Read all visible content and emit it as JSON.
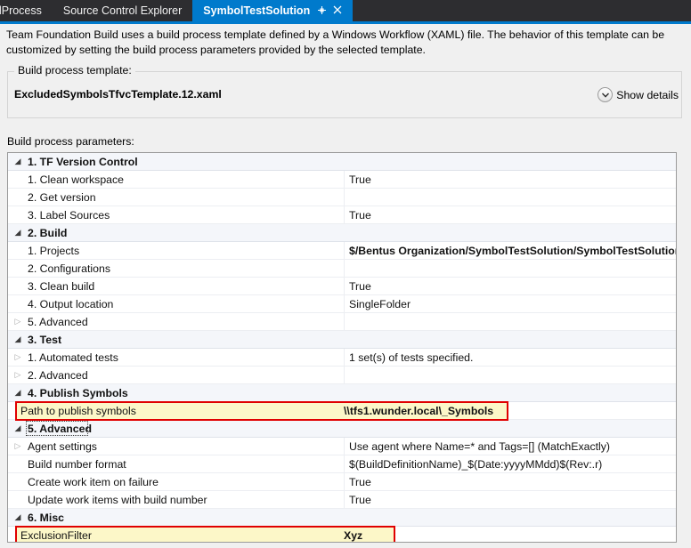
{
  "tabs": [
    {
      "label": "ldProcess",
      "active": false,
      "truncated": true
    },
    {
      "label": "Source Control Explorer",
      "active": false
    },
    {
      "label": "SymbolTestSolution",
      "active": true,
      "pin_icon": "pin-icon",
      "close_icon": "close-icon"
    }
  ],
  "intro": {
    "text": "Team Foundation Build uses a build process template defined by a Windows Workflow (XAML) file. The behavior of this template can be customized by setting the build process parameters provided by the selected template."
  },
  "template_group": {
    "legend": "Build process template:",
    "template_name": "ExcludedSymbolsTfvcTemplate.12.xaml",
    "show_details_label": "Show details",
    "show_details_icon": "chevron-down-circle-icon"
  },
  "params": {
    "label": "Build process parameters:",
    "rows": [
      {
        "type": "group",
        "expander": "open",
        "name": "1. TF Version Control",
        "value": ""
      },
      {
        "type": "item",
        "expander": "none",
        "name": "1. Clean workspace",
        "value": "True"
      },
      {
        "type": "item",
        "expander": "none",
        "name": "2. Get version",
        "value": ""
      },
      {
        "type": "item",
        "expander": "none",
        "name": "3. Label Sources",
        "value": "True"
      },
      {
        "type": "group",
        "expander": "open",
        "name": "2. Build",
        "value": ""
      },
      {
        "type": "item",
        "expander": "none",
        "name": "1. Projects",
        "value": "$/Bentus Organization/SymbolTestSolution/SymbolTestSolution.sln",
        "bold": true
      },
      {
        "type": "item",
        "expander": "none",
        "name": "2. Configurations",
        "value": ""
      },
      {
        "type": "item",
        "expander": "none",
        "name": "3. Clean build",
        "value": "True"
      },
      {
        "type": "item",
        "expander": "none",
        "name": "4. Output location",
        "value": "SingleFolder"
      },
      {
        "type": "item",
        "expander": "closed",
        "name": "5. Advanced",
        "value": ""
      },
      {
        "type": "group",
        "expander": "open",
        "name": "3. Test",
        "value": ""
      },
      {
        "type": "item",
        "expander": "closed",
        "name": "1. Automated tests",
        "value": "1 set(s) of tests specified."
      },
      {
        "type": "item",
        "expander": "closed",
        "name": "2. Advanced",
        "value": ""
      },
      {
        "type": "group",
        "expander": "open",
        "name": "4. Publish Symbols",
        "value": ""
      },
      {
        "type": "item",
        "expander": "none",
        "name": "Path to publish symbols",
        "value": "\\\\tfs1.wunder.local\\_Symbols",
        "highlighted": true,
        "bold": true
      },
      {
        "type": "group",
        "expander": "open",
        "name": "5. Advanced",
        "value": "",
        "focused": true
      },
      {
        "type": "item",
        "expander": "closed",
        "name": "Agent settings",
        "value": "Use agent where Name=* and Tags=[] (MatchExactly)"
      },
      {
        "type": "item",
        "expander": "none",
        "name": "Build number format",
        "value": "$(BuildDefinitionName)_$(Date:yyyyMMdd)$(Rev:.r)"
      },
      {
        "type": "item",
        "expander": "none",
        "name": "Create work item on failure",
        "value": "True"
      },
      {
        "type": "item",
        "expander": "none",
        "name": "Update work items with build number",
        "value": "True"
      },
      {
        "type": "group",
        "expander": "open",
        "name": "6. Misc",
        "value": ""
      },
      {
        "type": "item",
        "expander": "none",
        "name": "ExclusionFilter",
        "value": "Xyz",
        "highlighted": true,
        "bold": true
      }
    ]
  },
  "colors": {
    "tab_active": "#007acc",
    "tabstrip_bg": "#2d2d30",
    "highlight_fill": "#fcf7c8",
    "highlight_border": "#e00000",
    "group_row_bg": "#f4f6fa"
  },
  "glyphs": {
    "expander_open": "◢",
    "expander_closed": "▷",
    "chevron_down": "▼",
    "pin": "⊹",
    "close": "✕"
  }
}
